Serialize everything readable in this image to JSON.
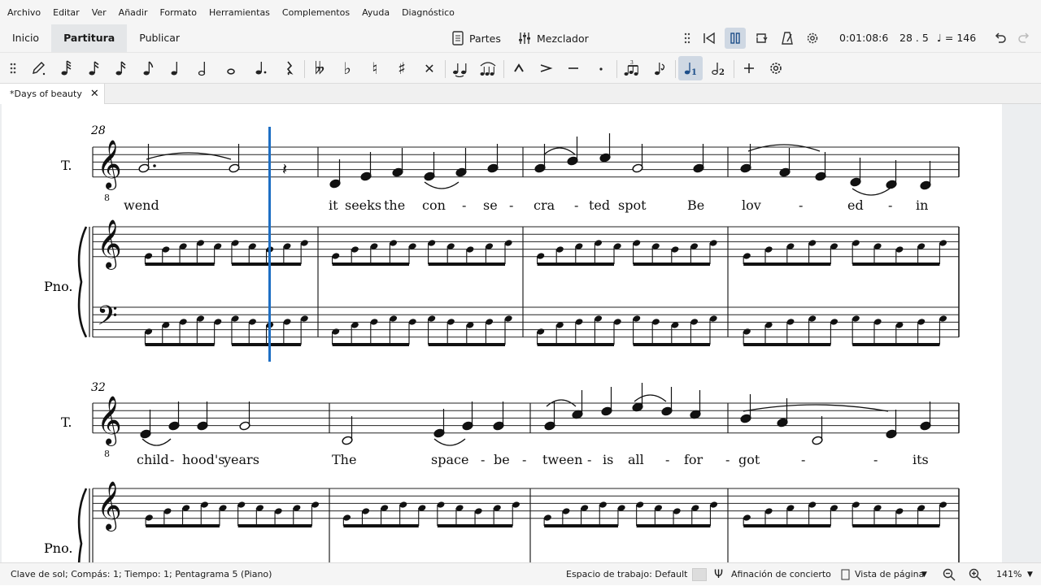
{
  "menu": [
    "Archivo",
    "Editar",
    "Ver",
    "Añadir",
    "Formato",
    "Herramientas",
    "Complementos",
    "Ayuda",
    "Diagnóstico"
  ],
  "tabs": {
    "home": "Inicio",
    "score": "Partitura",
    "publish": "Publicar"
  },
  "toolbar": {
    "parts": "Partes",
    "mixer": "Mezclador",
    "time": "0:01:08:6",
    "position": "28 . 5",
    "tempo": "= 146"
  },
  "palette_icons": [
    "grip-icon",
    "note-input-pencil-icon",
    "64th-note-icon",
    "32nd-note-icon",
    "16th-note-icon",
    "eighth-note-icon",
    "quarter-note-icon",
    "half-note-icon",
    "whole-note-icon",
    "dot-icon",
    "rest-icon",
    "double-flat-icon",
    "flat-icon",
    "natural-icon",
    "sharp-icon",
    "double-sharp-icon",
    "tie-icon",
    "slur-icon",
    "marcato-icon",
    "accent-icon",
    "tenuto-icon",
    "staccato-icon",
    "tuplet-icon",
    "flip-icon",
    "voice-1-icon",
    "voice-2-icon",
    "add-icon",
    "customize-icon"
  ],
  "document": {
    "tab_title": "*Days of beauty"
  },
  "score": {
    "system1": {
      "measure_number": "28",
      "tenor_label": "T.",
      "piano_label": "Pno.",
      "lyrics": [
        "wend",
        "it",
        "seeks",
        "the",
        "con",
        "-",
        "se",
        "-",
        "cra",
        "-",
        "ted",
        "spot",
        "Be",
        "lov",
        "-",
        "ed",
        "-",
        "in"
      ]
    },
    "system2": {
      "measure_number": "32",
      "tenor_label": "T.",
      "piano_label": "Pno.",
      "lyrics": [
        "child",
        "-",
        "hood's",
        "years",
        "The",
        "space",
        "-",
        "be",
        "-",
        "tween",
        "-",
        "is",
        "all",
        "-",
        "for",
        "-",
        "got",
        "-",
        "-",
        "its"
      ]
    }
  },
  "status": {
    "selection": "Clave de sol; Compás: 1; Tiempo: 1; Pentagrama 5 (Piano)",
    "workspace": "Espacio de trabajo: Default",
    "concert_pitch": "Afinación de concierto",
    "view_mode": "Vista de página",
    "zoom": "141%"
  },
  "colors": {
    "accent": "#1e6fc4",
    "selected_bg": "#cfd8e3",
    "chrome": "#f5f5f5"
  }
}
